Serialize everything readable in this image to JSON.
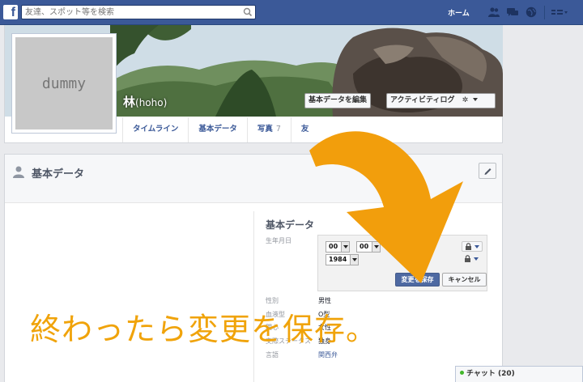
{
  "topbar": {
    "logo_letter": "f",
    "search_placeholder": "友達、スポット等を検索",
    "home_label": "ホーム"
  },
  "profile": {
    "placeholder_text": "dummy",
    "name": "林",
    "name_sub": "(hoho)",
    "edit_basic_label": "基本データを編集",
    "activity_log_label": "アクティビティログ",
    "settings_glyph": "✲",
    "tabs": [
      {
        "label": "タイムライン",
        "count": ""
      },
      {
        "label": "基本データ",
        "count": ""
      },
      {
        "label": "写真",
        "count": "7"
      },
      {
        "label": "友",
        "count": ""
      }
    ]
  },
  "card": {
    "title": "基本データ",
    "section_title": "基本データ",
    "birthday_label": "生年月日",
    "birthday_month": "00",
    "birthday_day": "00",
    "birthday_year": "1984",
    "save_label": "変更を保存",
    "cancel_label": "キャンセル",
    "rows": [
      {
        "label": "性別",
        "value": "男性"
      },
      {
        "label": "血液型",
        "value": "O型"
      },
      {
        "label": "関心",
        "value": "女性"
      },
      {
        "label": "交際ステータス",
        "value": "独身"
      },
      {
        "label": "言語",
        "value": "関西弁"
      }
    ]
  },
  "overlay": {
    "caption": "終わったら変更を保存。",
    "arrow_color": "#f0a30a"
  },
  "chat": {
    "label": "チャット (20)"
  },
  "colors": {
    "brand": "#3b5998",
    "save_button": "#4e69a2"
  }
}
